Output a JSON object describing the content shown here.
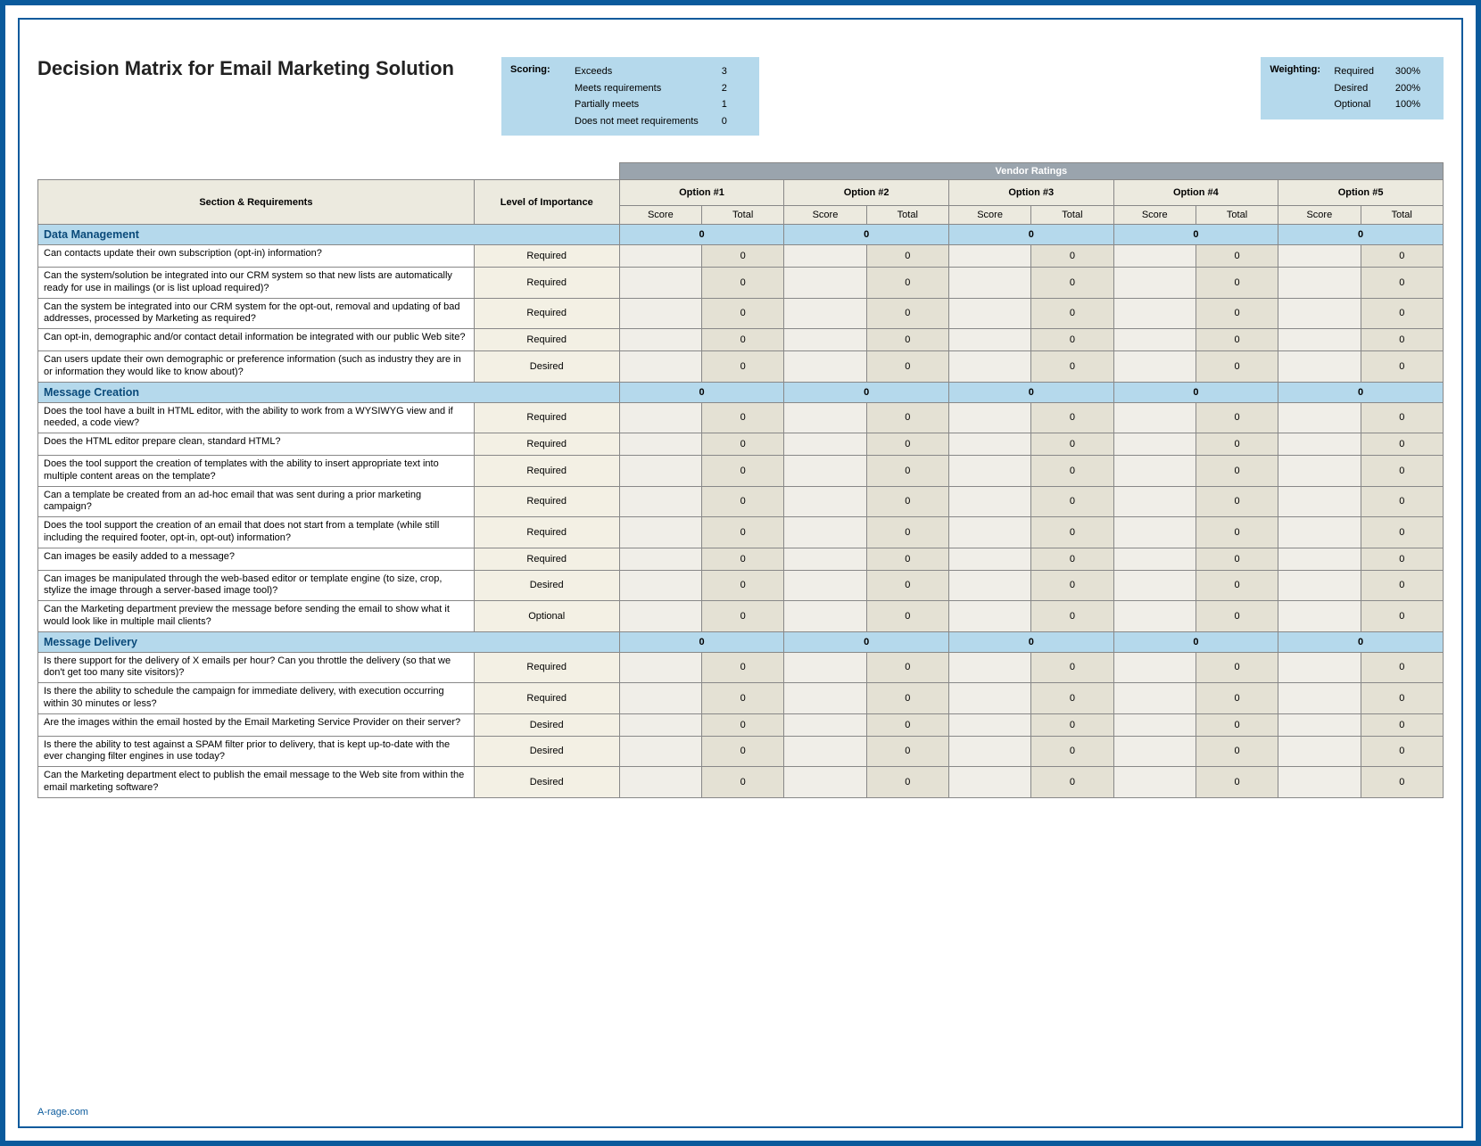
{
  "title": "Decision Matrix for Email Marketing Solution",
  "scoring": {
    "label": "Scoring:",
    "rows": [
      {
        "text": "Exceeds",
        "value": "3"
      },
      {
        "text": "Meets requirements",
        "value": "2"
      },
      {
        "text": "Partially meets",
        "value": "1"
      },
      {
        "text": "Does not meet requirements",
        "value": "0"
      }
    ]
  },
  "weighting": {
    "label": "Weighting:",
    "rows": [
      {
        "text": "Required",
        "value": "300%"
      },
      {
        "text": "Desired",
        "value": "200%"
      },
      {
        "text": "Optional",
        "value": "100%"
      }
    ]
  },
  "table": {
    "vendor_ratings_header": "Vendor Ratings",
    "col_section": "Section & Requirements",
    "col_importance": "Level of Importance",
    "options": [
      "Option #1",
      "Option #2",
      "Option #3",
      "Option #4",
      "Option #5"
    ],
    "sub_score": "Score",
    "sub_total": "Total"
  },
  "sections": [
    {
      "name": "Data Management",
      "totals": [
        "0",
        "0",
        "0",
        "0",
        "0"
      ],
      "rows": [
        {
          "req": "Can contacts update their own subscription (opt-in) information?",
          "imp": "Required",
          "totals": [
            "0",
            "0",
            "0",
            "0",
            "0"
          ]
        },
        {
          "req": "Can the system/solution be integrated into our CRM system so that new lists are automatically ready for use in mailings (or is list upload required)?",
          "imp": "Required",
          "totals": [
            "0",
            "0",
            "0",
            "0",
            "0"
          ]
        },
        {
          "req": "Can the system be integrated into our CRM system for the opt-out, removal and updating of bad addresses, processed by Marketing as required?",
          "imp": "Required",
          "totals": [
            "0",
            "0",
            "0",
            "0",
            "0"
          ]
        },
        {
          "req": "Can opt-in, demographic and/or contact detail information be integrated with our public Web site?",
          "imp": "Required",
          "totals": [
            "0",
            "0",
            "0",
            "0",
            "0"
          ]
        },
        {
          "req": "Can users update their own demographic or preference information (such as industry they are in or information they would like to know about)?",
          "imp": "Desired",
          "totals": [
            "0",
            "0",
            "0",
            "0",
            "0"
          ]
        }
      ]
    },
    {
      "name": "Message Creation",
      "totals": [
        "0",
        "0",
        "0",
        "0",
        "0"
      ],
      "rows": [
        {
          "req": "Does the tool have a built in HTML editor, with the ability to work from a WYSIWYG view and if needed, a code view?",
          "imp": "Required",
          "totals": [
            "0",
            "0",
            "0",
            "0",
            "0"
          ]
        },
        {
          "req": "Does the HTML editor prepare clean, standard HTML?",
          "imp": "Required",
          "totals": [
            "0",
            "0",
            "0",
            "0",
            "0"
          ]
        },
        {
          "req": "Does the tool support the creation of templates with the ability to insert appropriate text into multiple content areas on the template?",
          "imp": "Required",
          "totals": [
            "0",
            "0",
            "0",
            "0",
            "0"
          ]
        },
        {
          "req": "Can a template be created from an ad-hoc email that was sent during a prior marketing campaign?",
          "imp": "Required",
          "totals": [
            "0",
            "0",
            "0",
            "0",
            "0"
          ]
        },
        {
          "req": "Does the tool support the creation of an email that does not start from a template (while still including the required footer, opt-in, opt-out) information?",
          "imp": "Required",
          "totals": [
            "0",
            "0",
            "0",
            "0",
            "0"
          ]
        },
        {
          "req": "Can images be easily added to a message?",
          "imp": "Required",
          "totals": [
            "0",
            "0",
            "0",
            "0",
            "0"
          ]
        },
        {
          "req": "Can images be manipulated through the web-based editor or template engine (to size, crop, stylize the image through a server-based image tool)?",
          "imp": "Desired",
          "totals": [
            "0",
            "0",
            "0",
            "0",
            "0"
          ]
        },
        {
          "req": "Can the Marketing department preview the message before sending the email to show what it would look like in multiple mail clients?",
          "imp": "Optional",
          "totals": [
            "0",
            "0",
            "0",
            "0",
            "0"
          ]
        }
      ]
    },
    {
      "name": "Message Delivery",
      "totals": [
        "0",
        "0",
        "0",
        "0",
        "0"
      ],
      "rows": [
        {
          "req": "Is there support for the delivery of X emails per hour?  Can you throttle the delivery (so that we don't get too many site visitors)?",
          "imp": "Required",
          "totals": [
            "0",
            "0",
            "0",
            "0",
            "0"
          ]
        },
        {
          "req": "Is there the ability to schedule the campaign for immediate delivery, with execution occurring within 30 minutes or less?",
          "imp": "Required",
          "totals": [
            "0",
            "0",
            "0",
            "0",
            "0"
          ]
        },
        {
          "req": "Are the images within the email hosted by the Email Marketing Service Provider on their server?",
          "imp": "Desired",
          "totals": [
            "0",
            "0",
            "0",
            "0",
            "0"
          ]
        },
        {
          "req": "Is there the ability to test against a SPAM filter prior to delivery, that is kept up-to-date with the ever changing filter engines in use today?",
          "imp": "Desired",
          "totals": [
            "0",
            "0",
            "0",
            "0",
            "0"
          ]
        },
        {
          "req": "Can the Marketing department elect to publish the email message to the Web site from within the email marketing software?",
          "imp": "Desired",
          "totals": [
            "0",
            "0",
            "0",
            "0",
            "0"
          ]
        }
      ]
    }
  ],
  "footer": "A-rage.com"
}
